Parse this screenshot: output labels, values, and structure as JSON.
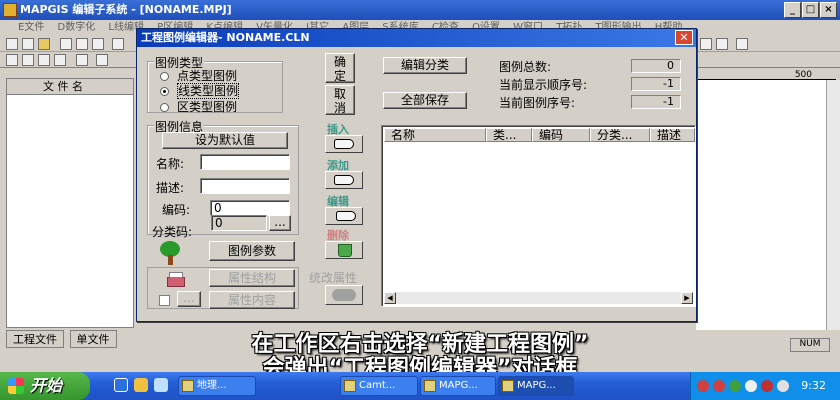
{
  "app": {
    "title": "MAPGIS 编辑子系统 - [NONAME.MPJ]",
    "menu": [
      "E文件",
      "D数字化",
      "L线编辑",
      "P区编辑",
      "K点编辑",
      "V矢量化",
      "I其它",
      "A图层",
      "S系统库",
      "C检查",
      "O设置",
      "W窗口",
      "T拓扑",
      "T图形输出",
      "H帮助"
    ],
    "ruler_value": "500",
    "status_num": "NUM"
  },
  "left_panel": {
    "header": "文 件 名",
    "tabs": [
      "工程文件",
      "单文件"
    ]
  },
  "dialog": {
    "title": "工程图例编辑器- NONAME.CLN",
    "type_group": {
      "label": "图例类型",
      "options": [
        "点类型图例",
        "线类型图例",
        "区类型图例"
      ],
      "selected": "线类型图例"
    },
    "ok_label": "确定",
    "cancel_label": "取消",
    "info_group": {
      "label": "图例信息",
      "set_default": "设为默认值",
      "name_label": "名称:",
      "desc_label": "描述:",
      "code_label": "编码:",
      "code_value": "0",
      "category_label": "分类码:",
      "category_value": "0",
      "browse": "..."
    },
    "legend_params": "图例参数",
    "attr_struct": "属性结构",
    "attr_content": "属性内容",
    "unify_attr": "统改属性",
    "actions": {
      "insert": "插入",
      "add": "添加",
      "edit": "编辑",
      "delete": "删除"
    },
    "edit_category": "编辑分类",
    "save_all": "全部保存",
    "stats": {
      "total_label": "图例总数:",
      "total_value": "0",
      "display_order_label": "当前显示顺序号:",
      "display_order_value": "-1",
      "current_seq_label": "当前图例序号:",
      "current_seq_value": "-1"
    },
    "table": {
      "columns": [
        "名称",
        "类...",
        "编码",
        "分类...",
        "描述"
      ],
      "rows": []
    }
  },
  "subtitle": {
    "line1": "在工作区右击选择“新建工程图例”",
    "line2": "会弹出“工程图例编辑器”对话框"
  },
  "taskbar": {
    "start": "开始",
    "tasks": [
      "地理...",
      "Camt...",
      "MAPG...",
      "MAPG..."
    ],
    "clock": "9:32"
  }
}
